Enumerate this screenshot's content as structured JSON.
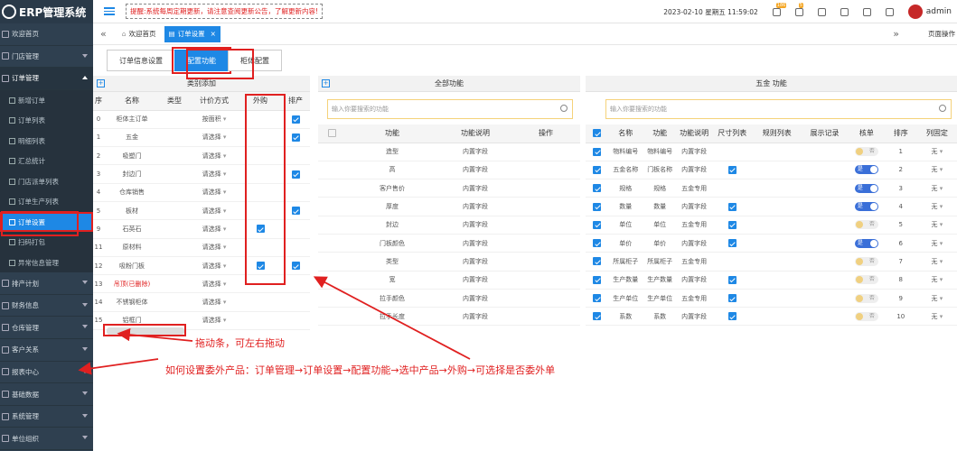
{
  "app": {
    "title": "ERP管理系统"
  },
  "sidebar": {
    "items": [
      {
        "label": "欢迎首页",
        "type": "item",
        "open": false
      },
      {
        "label": "门店管理",
        "type": "group",
        "open": false
      },
      {
        "label": "订单管理",
        "type": "group",
        "open": true
      },
      {
        "label": "新增订单",
        "type": "sub"
      },
      {
        "label": "订单列表",
        "type": "sub"
      },
      {
        "label": "明细列表",
        "type": "sub"
      },
      {
        "label": "汇总统计",
        "type": "sub"
      },
      {
        "label": "门店派单列表",
        "type": "sub"
      },
      {
        "label": "订单生产列表",
        "type": "sub"
      },
      {
        "label": "订单设置",
        "type": "sub",
        "active": true
      },
      {
        "label": "扫码打包",
        "type": "sub"
      },
      {
        "label": "异常信息管理",
        "type": "sub"
      },
      {
        "label": "排产计划",
        "type": "group"
      },
      {
        "label": "财务信息",
        "type": "group"
      },
      {
        "label": "仓库管理",
        "type": "group"
      },
      {
        "label": "客户关系",
        "type": "group"
      },
      {
        "label": "报表中心",
        "type": "group"
      },
      {
        "label": "基础数据",
        "type": "group"
      },
      {
        "label": "系统管理",
        "type": "group"
      },
      {
        "label": "单位组织",
        "type": "group"
      }
    ]
  },
  "topbar": {
    "notice": "提醒:系统每周定期更新，请注意查阅更新公告，了解更新内容!",
    "date": "2023-02-10",
    "weekday": "星期五",
    "time": "11:59:02",
    "badge1": "186",
    "badge2": "5",
    "user": "admin"
  },
  "tabs": {
    "home": "欢迎首页",
    "current": "订单设置",
    "close": "×",
    "ops": "页面操作"
  },
  "subtabs": [
    "订单信息设置",
    "配置功能",
    "柜体配置"
  ],
  "panel1": {
    "title": "类别添加",
    "headers": [
      "序",
      "名称",
      "类型",
      "计价方式",
      "外购",
      "排产"
    ],
    "rows": [
      {
        "no": "0",
        "name": "柜体主订单",
        "type": "",
        "price": "按面积",
        "out": false,
        "prod": true
      },
      {
        "no": "1",
        "name": "五金",
        "type": "",
        "price": "请选择",
        "out": false,
        "prod": true
      },
      {
        "no": "2",
        "name": "吸塑门",
        "type": "",
        "price": "请选择",
        "out": false,
        "prod": false
      },
      {
        "no": "3",
        "name": "封边门",
        "type": "",
        "price": "请选择",
        "out": false,
        "prod": true
      },
      {
        "no": "4",
        "name": "仓库销售",
        "type": "",
        "price": "请选择",
        "out": false,
        "prod": false
      },
      {
        "no": "5",
        "name": "板材",
        "type": "",
        "price": "请选择",
        "out": false,
        "prod": true
      },
      {
        "no": "9",
        "name": "石英石",
        "type": "",
        "price": "请选择",
        "out": true,
        "prod": false
      },
      {
        "no": "11",
        "name": "原材料",
        "type": "",
        "price": "请选择",
        "out": false,
        "prod": false
      },
      {
        "no": "12",
        "name": "吸粉门板",
        "type": "",
        "price": "请选择",
        "out": true,
        "prod": true
      },
      {
        "no": "13",
        "name": "吊顶(已删除)",
        "type": "",
        "price": "请选择",
        "out": false,
        "prod": false,
        "deleted": true
      },
      {
        "no": "14",
        "name": "不锈钢柜体",
        "type": "",
        "price": "请选择",
        "out": false,
        "prod": false
      },
      {
        "no": "15",
        "name": "铝框门",
        "type": "",
        "price": "请选择",
        "out": false,
        "prod": false
      }
    ]
  },
  "panel2": {
    "title": "全部功能",
    "search_placeholder": "输入你要搜索的功能",
    "headers": [
      "",
      "功能",
      "功能说明",
      "操作"
    ],
    "rows": [
      {
        "fn": "造型",
        "desc": "内置字段"
      },
      {
        "fn": "高",
        "desc": "内置字段"
      },
      {
        "fn": "客户售价",
        "desc": "内置字段"
      },
      {
        "fn": "厚度",
        "desc": "内置字段"
      },
      {
        "fn": "封边",
        "desc": "内置字段"
      },
      {
        "fn": "门板颜色",
        "desc": "内置字段"
      },
      {
        "fn": "类型",
        "desc": "内置字段"
      },
      {
        "fn": "宽",
        "desc": "内置字段"
      },
      {
        "fn": "拉手颜色",
        "desc": "内置字段"
      },
      {
        "fn": "拉手长度",
        "desc": "内置字段"
      }
    ]
  },
  "panel3": {
    "title": "五金 功能",
    "search_placeholder": "输入你要搜索的功能",
    "headers": [
      "",
      "名称",
      "功能",
      "功能说明",
      "尺寸列表",
      "规则列表",
      "展示记录",
      "核单",
      "排序",
      "列固定"
    ],
    "rows": [
      {
        "name": "物料编号",
        "fn": "物料编号",
        "desc": "内置字段",
        "size": false,
        "check": false,
        "sort": "1",
        "fix": "无"
      },
      {
        "name": "五金名称",
        "fn": "门板名称",
        "desc": "内置字段",
        "size": true,
        "check": true,
        "sort": "2",
        "fix": "无"
      },
      {
        "name": "规格",
        "fn": "规格",
        "desc": "五金专用",
        "size": false,
        "check": true,
        "sort": "3",
        "fix": "无"
      },
      {
        "name": "数量",
        "fn": "数量",
        "desc": "内置字段",
        "size": true,
        "check": true,
        "sort": "4",
        "fix": "无"
      },
      {
        "name": "单位",
        "fn": "单位",
        "desc": "五金专用",
        "size": true,
        "check": false,
        "sort": "5",
        "fix": "无"
      },
      {
        "name": "单价",
        "fn": "单价",
        "desc": "内置字段",
        "size": true,
        "check": true,
        "sort": "6",
        "fix": "无"
      },
      {
        "name": "所属柜子",
        "fn": "所属柜子",
        "desc": "五金专用",
        "size": false,
        "check": false,
        "sort": "7",
        "fix": "无"
      },
      {
        "name": "生产数量",
        "fn": "生产数量",
        "desc": "内置字段",
        "size": true,
        "check": false,
        "sort": "8",
        "fix": "无"
      },
      {
        "name": "生产单位",
        "fn": "生产单位",
        "desc": "五金专用",
        "size": true,
        "check": false,
        "sort": "9",
        "fix": "无"
      },
      {
        "name": "系数",
        "fn": "系数",
        "desc": "内置字段",
        "size": true,
        "check": false,
        "sort": "10",
        "fix": "无"
      }
    ],
    "switch_on": "是",
    "switch_off": "否",
    "select_placeholder": "请选择"
  },
  "annotations": {
    "drag": "拖动条，可左右拖动",
    "howto": "如何设置委外产品：订单管理→订单设置→配置功能→选中产品→外购→可选择是否委外单"
  }
}
